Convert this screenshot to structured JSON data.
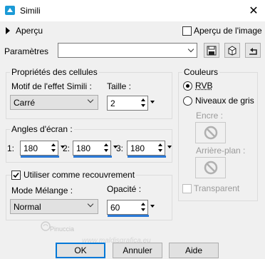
{
  "window": {
    "title": "Simili"
  },
  "preview": {
    "label": "Aperçu",
    "image_label": "Aperçu de l'image",
    "image_checked": false
  },
  "presets": {
    "label": "Paramètres",
    "value": ""
  },
  "props": {
    "title": "Propriétés des cellules",
    "motif_label": "Motif de l'effet Simili :",
    "motif_value": "Carré",
    "size_label": "Taille :",
    "size_value": "2"
  },
  "angles": {
    "title": "Angles d'écran :",
    "items": [
      {
        "label": "1:",
        "value": "180"
      },
      {
        "label": "2:",
        "value": "180"
      },
      {
        "label": "3:",
        "value": "180"
      }
    ]
  },
  "overlay": {
    "label": "Utiliser comme recouvrement",
    "checked": true,
    "mode_label": "Mode Mélange :",
    "mode_value": "Normal",
    "opacity_label": "Opacité :",
    "opacity_value": "60"
  },
  "colors": {
    "title": "Couleurs",
    "rgb": "RVB",
    "gray": "Niveaux de gris",
    "selected": "RVB",
    "ink": "Encre :",
    "bg": "Arrière-plan :",
    "transparent": "Transparent"
  },
  "watermark": {
    "text": "Pinuccia",
    "url": "www.maldisgrafica.eu"
  },
  "buttons": {
    "ok": "OK",
    "cancel": "Annuler",
    "help": "Aide"
  },
  "theme": {
    "accent": "#0078d7",
    "spin_bar": "#2b79d6"
  }
}
